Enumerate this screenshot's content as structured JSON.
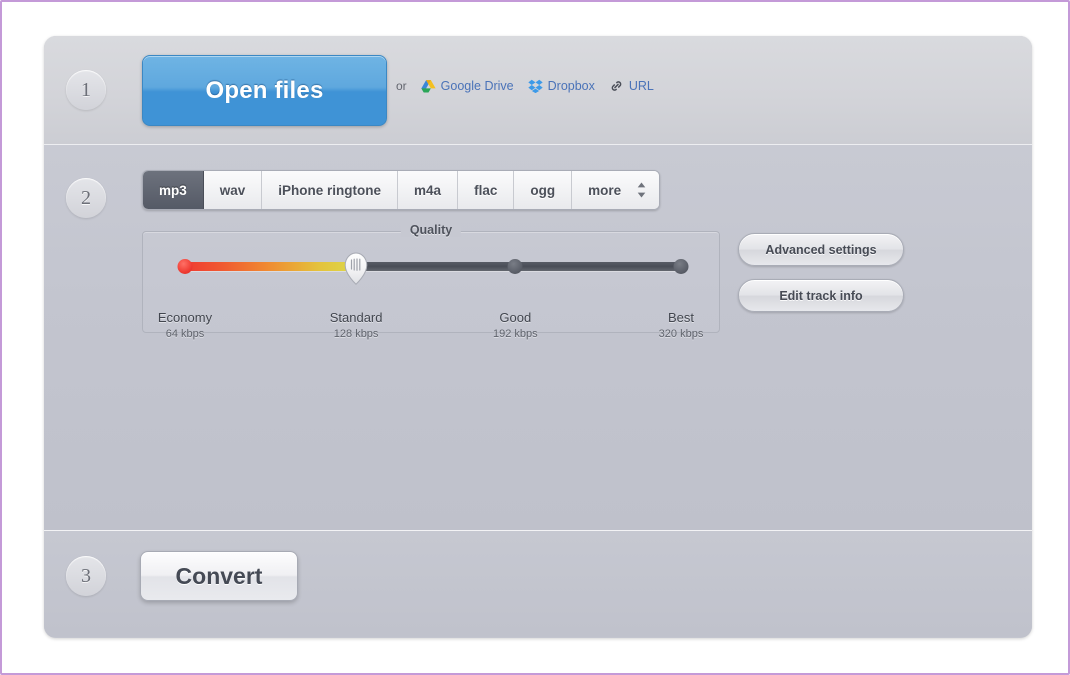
{
  "theme": {
    "page_border_color": "#c49ad8",
    "panel_bg": "#c3c5cf",
    "accent_blue": "#3f93d6",
    "link_blue": "#4a73b8",
    "active_tab_bg": "#555a66"
  },
  "steps": {
    "one": "1",
    "two": "2",
    "three": "3"
  },
  "step1": {
    "open_files_label": "Open files",
    "or_label": "or",
    "sources": [
      {
        "label": "Google Drive",
        "icon": "google-drive-icon"
      },
      {
        "label": "Dropbox",
        "icon": "dropbox-icon"
      },
      {
        "label": "URL",
        "icon": "link-icon"
      }
    ]
  },
  "step2": {
    "formats": [
      {
        "label": "mp3",
        "active": true
      },
      {
        "label": "wav",
        "active": false
      },
      {
        "label": "iPhone ringtone",
        "active": false
      },
      {
        "label": "m4a",
        "active": false
      },
      {
        "label": "flac",
        "active": false
      },
      {
        "label": "ogg",
        "active": false
      },
      {
        "label": "more",
        "active": false
      }
    ],
    "stepper_icon": "up-down-arrows-icon",
    "quality": {
      "legend": "Quality",
      "selected": "Standard",
      "selected_value": "128 kbps",
      "stops": [
        {
          "name": "Economy",
          "bitrate": "64 kbps",
          "position": 0
        },
        {
          "name": "Standard",
          "bitrate": "128 kbps",
          "position": 34.5
        },
        {
          "name": "Good",
          "bitrate": "192 kbps",
          "position": 66.6
        },
        {
          "name": "Best",
          "bitrate": "320 kbps",
          "position": 100
        }
      ]
    },
    "advanced_settings_label": "Advanced settings",
    "edit_track_info_label": "Edit track info"
  },
  "step3": {
    "convert_label": "Convert"
  }
}
